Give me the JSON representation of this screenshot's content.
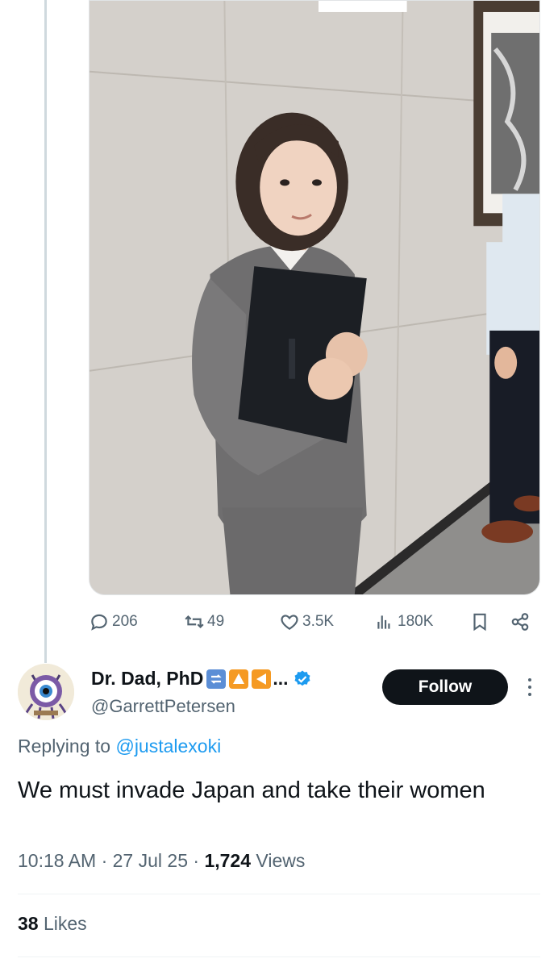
{
  "media": {
    "alt": "Photo of a woman in a grey suit holding a black folder"
  },
  "actions": {
    "replies": "206",
    "reposts": "49",
    "likes": "3.5K",
    "views": "180K"
  },
  "reply": {
    "display_name": "Dr. Dad, PhD",
    "name_suffix": "...",
    "handle": "@GarrettPetersen",
    "follow_label": "Follow",
    "replying_prefix": "Replying to",
    "replying_to": "@justalexoki",
    "text": "We must invade Japan and take their women",
    "time": "10:18 AM",
    "date": "27 Jul 25",
    "views_count": "1,724",
    "views_label": "Views",
    "likes_count": "38",
    "likes_label": "Likes"
  },
  "colors": {
    "accent": "#1d9bf0",
    "text_primary": "#0f1419",
    "text_secondary": "#536471",
    "follow_bg": "#0f1419",
    "verified": "#1d9bf0"
  },
  "icons": {
    "reply": "speech-bubble-icon",
    "repost": "repost-arrows-icon",
    "like": "heart-icon",
    "views": "bar-chart-icon",
    "bookmark": "bookmark-icon",
    "share": "share-icon",
    "verified": "verified-badge-icon",
    "more": "more-vertical-icon"
  }
}
